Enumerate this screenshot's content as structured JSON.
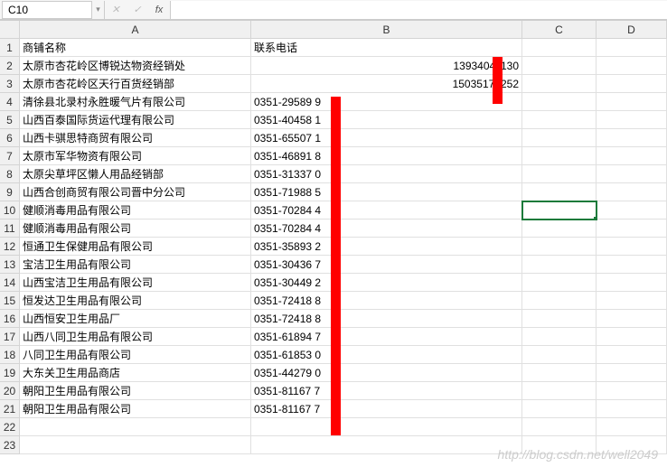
{
  "formula_bar": {
    "name_box": "C10",
    "cancel": "✕",
    "confirm": "✓",
    "fx": "fx",
    "value": ""
  },
  "columns": [
    "A",
    "B",
    "C",
    "D"
  ],
  "rows": [
    {
      "n": 1,
      "a": "商铺名称",
      "b": "联系电话",
      "b_align": "l"
    },
    {
      "n": 2,
      "a": "太原市杏花岭区博锐达物资经销处",
      "b": "13934041130",
      "b_align": "r"
    },
    {
      "n": 3,
      "a": "太原市杏花岭区天行百货经销部",
      "b": "15035171252",
      "b_align": "r"
    },
    {
      "n": 4,
      "a": "清徐县北录村永胜暖气片有限公司",
      "b": "0351-29589 9",
      "b_align": "l"
    },
    {
      "n": 5,
      "a": "山西百泰国际货运代理有限公司",
      "b": "0351-40458 1",
      "b_align": "l"
    },
    {
      "n": 6,
      "a": "山西卡骐思特商贸有限公司",
      "b": "0351-65507 1",
      "b_align": "l"
    },
    {
      "n": 7,
      "a": "太原市军华物资有限公司",
      "b": "0351-46891 8",
      "b_align": "l"
    },
    {
      "n": 8,
      "a": "太原尖草坪区懒人用品经销部",
      "b": "0351-31337 0",
      "b_align": "l"
    },
    {
      "n": 9,
      "a": "山西合创商贸有限公司晋中分公司",
      "b": "0351-71988 5",
      "b_align": "l"
    },
    {
      "n": 10,
      "a": "健顺消毒用品有限公司",
      "b": "0351-70284 4",
      "b_align": "l",
      "sel": true
    },
    {
      "n": 11,
      "a": "健顺消毒用品有限公司",
      "b": "0351-70284 4",
      "b_align": "l"
    },
    {
      "n": 12,
      "a": "恒通卫生保健用品有限公司",
      "b": "0351-35893 2",
      "b_align": "l"
    },
    {
      "n": 13,
      "a": "宝洁卫生用品有限公司",
      "b": "0351-30436 7",
      "b_align": "l"
    },
    {
      "n": 14,
      "a": "山西宝洁卫生用品有限公司",
      "b": "0351-30449 2",
      "b_align": "l"
    },
    {
      "n": 15,
      "a": "恒发达卫生用品有限公司",
      "b": "0351-72418 8",
      "b_align": "l"
    },
    {
      "n": 16,
      "a": "山西恒安卫生用品厂",
      "b": "0351-72418 8",
      "b_align": "l"
    },
    {
      "n": 17,
      "a": "山西八同卫生用品有限公司",
      "b": "0351-61894 7",
      "b_align": "l"
    },
    {
      "n": 18,
      "a": "八同卫生用品有限公司",
      "b": "0351-61853 0",
      "b_align": "l"
    },
    {
      "n": 19,
      "a": "大东关卫生用品商店",
      "b": "0351-44279 0",
      "b_align": "l"
    },
    {
      "n": 20,
      "a": "朝阳卫生用品有限公司",
      "b": "0351-81167 7",
      "b_align": "l"
    },
    {
      "n": 21,
      "a": "朝阳卫生用品有限公司",
      "b": "0351-81167 7",
      "b_align": "l"
    },
    {
      "n": 22,
      "a": "",
      "b": "",
      "b_align": "l"
    },
    {
      "n": 23,
      "a": "",
      "b": "",
      "b_align": "l"
    }
  ],
  "watermark": "http://blog.csdn.net/well2049"
}
